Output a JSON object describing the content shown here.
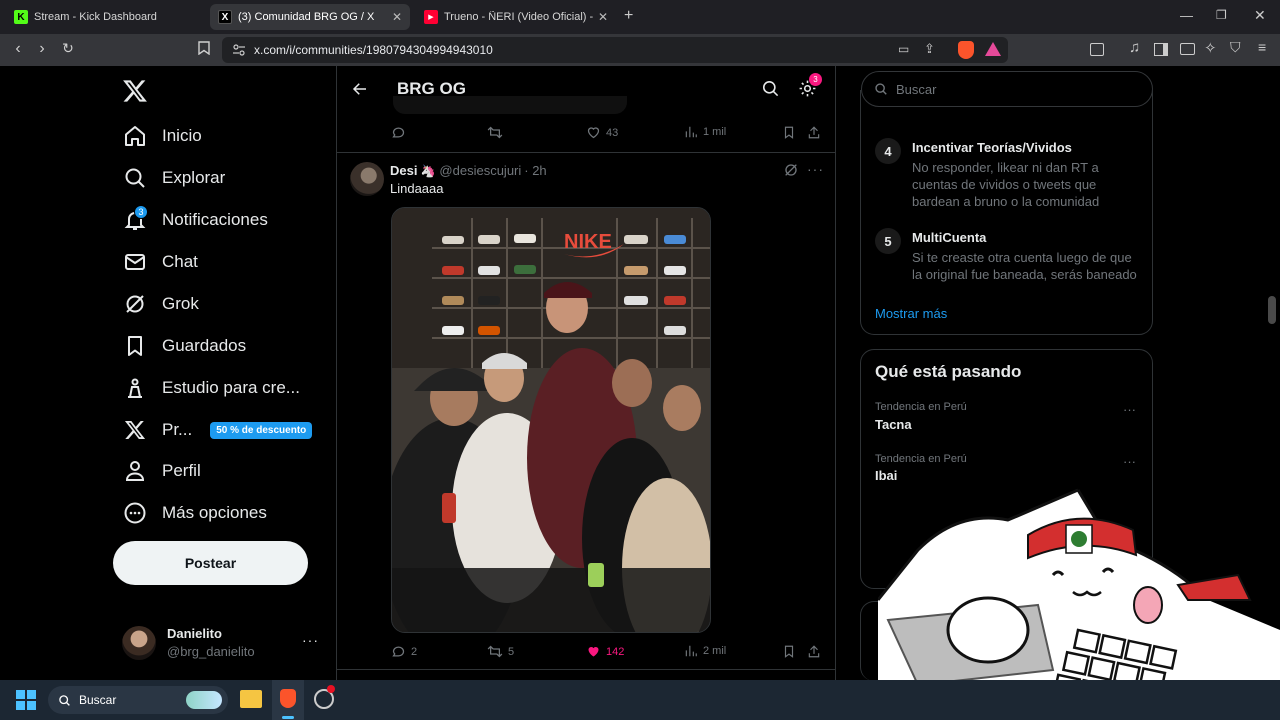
{
  "tabs": [
    {
      "title": "Stream - Kick Dashboard",
      "favicon": "kick-icon",
      "color": "#53fc18"
    },
    {
      "title": "(3) Comunidad BRG OG / X",
      "favicon": "x-icon",
      "color": "#ffffff"
    },
    {
      "title": "Trueno - ÑERI (Video Oficial) - Yo",
      "favicon": "youtube-icon",
      "color": "#ff0033"
    }
  ],
  "address": {
    "url": "x.com/i/communities/1980794304994943010"
  },
  "sidebar": {
    "items": [
      {
        "label": "Inicio",
        "icon": "home-icon"
      },
      {
        "label": "Explorar",
        "icon": "search-icon"
      },
      {
        "label": "Notificaciones",
        "icon": "bell-icon",
        "badge": "3"
      },
      {
        "label": "Chat",
        "icon": "mail-icon"
      },
      {
        "label": "Grok",
        "icon": "grok-icon"
      },
      {
        "label": "Guardados",
        "icon": "bookmark-icon"
      },
      {
        "label": "Estudio para cre...",
        "icon": "creator-studio-icon"
      },
      {
        "label": "Pr...",
        "icon": "x-premium-icon",
        "promo": "50 % de descuento"
      },
      {
        "label": "Perfil",
        "icon": "person-icon"
      },
      {
        "label": "Más opciones",
        "icon": "more-circle-icon"
      }
    ],
    "post_label": "Postear",
    "account": {
      "name": "Danielito",
      "handle": "@brg_danielito"
    }
  },
  "header": {
    "title": "BRG OG",
    "settings_badge": "3"
  },
  "prev_post": {
    "replies": "",
    "reposts": "",
    "likes": "43",
    "views": "1 mil"
  },
  "post": {
    "author": "Desi",
    "handle": "@desiescujuri",
    "time": "· 2h",
    "text": "Lindaaaa",
    "replies": "2",
    "reposts": "5",
    "likes": "142",
    "views": "2 mil",
    "image_wall_text": "NIKE"
  },
  "search": {
    "placeholder": "Buscar"
  },
  "rules": {
    "items": [
      {
        "number": "4",
        "title": "Incentivar Teorías/Vividos",
        "description": "No responder, likear ni dan RT a cuentas de vividos o tweets que bardean a bruno o la comunidad"
      },
      {
        "number": "5",
        "title": "MultiCuenta",
        "description": "Si te creaste otra cuenta luego de que la original fue baneada, serás baneado"
      }
    ],
    "show_more": "Mostrar más"
  },
  "trends": {
    "title": "Qué está pasando",
    "items": [
      {
        "context": "Tendencia en Perú",
        "name": "Tacna"
      },
      {
        "context": "Tendencia en Perú",
        "name": "Ibai"
      }
    ]
  },
  "taskbar": {
    "search_placeholder": "Buscar"
  },
  "colors": {
    "accent": "#1d9bf0",
    "like": "#f91880",
    "badge": "#1d9bf0",
    "settings_badge": "#f91880"
  }
}
